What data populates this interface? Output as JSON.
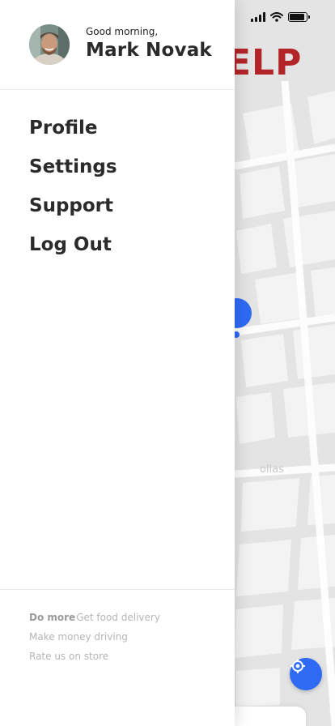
{
  "colors": {
    "brand_red": "#b32428",
    "accent_blue": "#2f6af5",
    "map_bg": "#e6e6e6",
    "map_block": "#f4f4f4"
  },
  "map": {
    "brand_text": "ELP",
    "street_label": "ollas"
  },
  "status_bar": {
    "signal_icon": "cellular-signal-icon",
    "wifi_icon": "wifi-icon",
    "battery_icon": "battery-icon",
    "battery_level": 0.9
  },
  "drawer": {
    "greeting": "Good morning,",
    "user_name": "Mark Novak",
    "avatar_icon": "user-avatar",
    "menu": [
      {
        "label": "Profile"
      },
      {
        "label": "Settings"
      },
      {
        "label": "Support"
      },
      {
        "label": "Log Out"
      }
    ],
    "footer": {
      "do_more_label": "Do more",
      "food_delivery": "Get food delivery",
      "drive": "Make money driving",
      "rate": "Rate us on store"
    }
  },
  "locate_button_icon": "crosshair-location-icon"
}
